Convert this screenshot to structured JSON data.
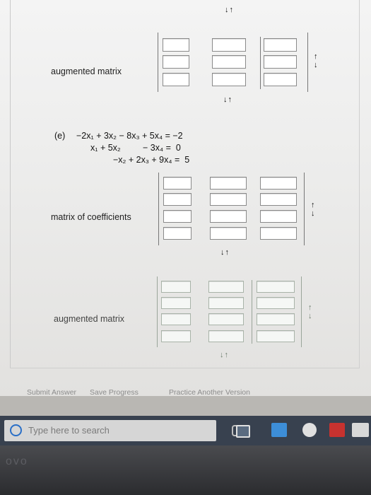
{
  "top_arrows": "↓↑",
  "section_d": {
    "augmented_label": "augmented matrix",
    "right_arrows": [
      "↑",
      "↓"
    ],
    "bottom_arrows": "↓↑"
  },
  "section_e": {
    "part_label": "(e)",
    "equations": [
      "−2x₁ + 3x₂ − 8x₃ + 5x₄ = −2",
      "x₁ + 5x₂         − 3x₄ =  0",
      "−x₂ + 2x₃ + 9x₄ =  5"
    ],
    "coefficients_label": "matrix of coefficients",
    "augmented_label": "augmented matrix",
    "right_arrows": [
      "↑",
      "↓"
    ],
    "bottom_arrows": "↓↑"
  },
  "actions": {
    "submit": "Submit Answer",
    "save": "Save Progress",
    "practice": "Practice Another Version"
  },
  "taskbar": {
    "search_placeholder": "Type here to search"
  },
  "bezel": {
    "brand": "ovo"
  }
}
